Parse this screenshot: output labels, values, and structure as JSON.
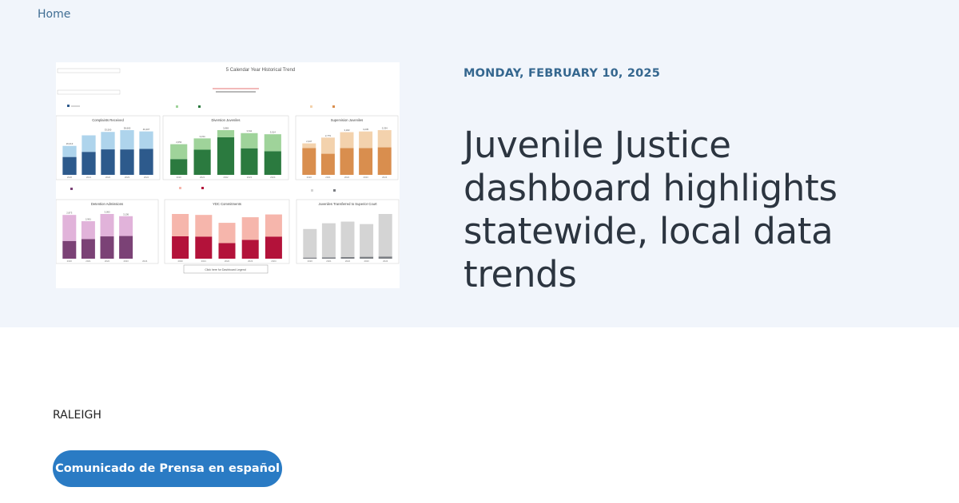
{
  "breadcrumb": {
    "home_label": "Home"
  },
  "article": {
    "date": "MONDAY, FEBRUARY 10, 2025",
    "headline": "Juvenile Justice dashboard highlights statewide, local data trends",
    "dateline": "RALEIGH",
    "spanish_button_label": "Comunicado de Prensa en español"
  },
  "colors": {
    "hero_bg": "#f1f5fb",
    "accent": "#35678f",
    "button": "#2a7bc4"
  },
  "dashboard_image": {
    "title": "5 Calendar Year Historical Trend",
    "footer_button": "Click here for Dashboard Legend",
    "chart_data": [
      {
        "type": "bar",
        "title": "Complaints Received",
        "categories": [
          "2020",
          "2021",
          "2022",
          "2023",
          "2024"
        ],
        "totals": [
          "26,013",
          "",
          "33,500",
          "38,665",
          "40,407"
        ],
        "series": [
          {
            "values": [
              16170,
              20807,
              23071,
              23031,
              23502
            ]
          },
          {
            "values": [
              10039,
              14950,
              15774,
              17432,
              15800
            ]
          }
        ],
        "colors": [
          "#2d5a8c",
          "#aed4ec"
        ]
      },
      {
        "type": "bar",
        "title": "Diversion Juveniles",
        "categories": [
          "2020",
          "2021",
          "2022",
          "2023",
          "2024"
        ],
        "totals": [
          "2,653",
          "3,154",
          "3,869",
          "3,611",
          "3,514"
        ],
        "series": [
          {
            "values": [
              1367,
              2176,
              3259,
              2300,
              2048
            ]
          },
          {
            "values": [
              1286,
              978,
              610,
              1311,
              1466
            ]
          }
        ],
        "colors": [
          "#2b7a3f",
          "#9fd39a"
        ]
      },
      {
        "type": "bar",
        "title": "Supervision Juveniles",
        "categories": [
          "2020",
          "2021",
          "2022",
          "2023",
          "2024"
        ],
        "totals": [
          "2,347",
          "2,779",
          "3,182",
          "3,235",
          "3,334"
        ],
        "series": [
          {
            "values": [
              2000,
              1574,
              2000,
              2000,
              2051
            ]
          },
          {
            "values": [
              347,
              1205,
              1182,
              1235,
              1283
            ]
          }
        ],
        "colors": [
          "#d98e4e",
          "#f3d2ad"
        ]
      },
      {
        "type": "bar",
        "title": "Detention Admissions",
        "categories": [
          "2020",
          "2021",
          "2022",
          "2023",
          "2024"
        ],
        "totals": [
          "2,873",
          "2,961",
          "3,093",
          "3,136",
          ""
        ],
        "series": [
          {
            "values": [
              1166,
              1293,
              1466,
              1491,
              0
            ]
          },
          {
            "values": [
              1707,
              1168,
              1470,
              1300,
              0
            ]
          }
        ],
        "colors": [
          "#7b4276",
          "#e1b3da"
        ]
      },
      {
        "type": "bar",
        "title": "YDC Commitments",
        "categories": [
          "2020",
          "2021",
          "2022",
          "2023",
          "2024"
        ],
        "totals": [
          "",
          "",
          "",
          "",
          ""
        ],
        "series": [
          {
            "values": [
              96,
              95,
              67,
              81,
              95
            ]
          },
          {
            "values": [
              96,
              93,
              87,
              97,
              95
            ]
          }
        ],
        "colors": [
          "#b3123a",
          "#f6b6ac"
        ]
      },
      {
        "type": "bar",
        "title": "Juveniles Transferred to Superior Court",
        "categories": [
          "2020",
          "2021",
          "2022",
          "2023",
          "2024"
        ],
        "totals": [
          "",
          "",
          "",
          "",
          ""
        ],
        "series": [
          {
            "values": [
              8,
              10,
              12,
              14,
              16
            ]
          },
          {
            "values": [
              210,
              250,
              260,
              240,
              312
            ]
          }
        ],
        "colors": [
          "#7b7e83",
          "#d4d4d4"
        ]
      }
    ]
  }
}
